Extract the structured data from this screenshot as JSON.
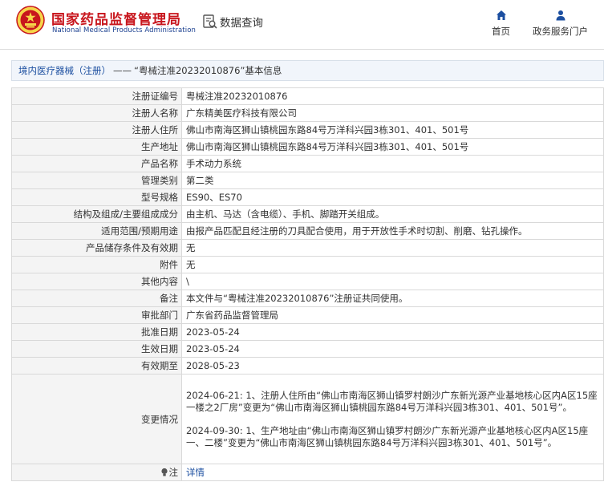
{
  "header": {
    "site_name_cn": "国家药品监督管理局",
    "site_name_en": "National Medical Products Administration",
    "data_query": "数据查询",
    "nav": {
      "home": "首页",
      "gov_service": "政务服务门户"
    }
  },
  "breadcrumb": {
    "category": "境内医疗器械（注册）",
    "separator": "——",
    "title": "“粤械注准20232010876”基本信息"
  },
  "record": {
    "rows": [
      {
        "label": "注册证编号",
        "value": "粤械注准20232010876"
      },
      {
        "label": "注册人名称",
        "value": "广东精美医疗科技有限公司"
      },
      {
        "label": "注册人住所",
        "value": "佛山市南海区狮山镇桃园东路84号万洋科兴园3栋301、401、501号"
      },
      {
        "label": "生产地址",
        "value": "佛山市南海区狮山镇桃园东路84号万洋科兴园3栋301、401、501号"
      },
      {
        "label": "产品名称",
        "value": "手术动力系统"
      },
      {
        "label": "管理类别",
        "value": "第二类"
      },
      {
        "label": "型号规格",
        "value": "ES90、ES70"
      },
      {
        "label": "结构及组成/主要组成成分",
        "value": "由主机、马达（含电缆）、手机、脚踏开关组成。"
      },
      {
        "label": "适用范围/预期用途",
        "value": "由报产品匹配且经注册的刀具配合使用，用于开放性手术时切割、削磨、钻孔操作。"
      },
      {
        "label": "产品储存条件及有效期",
        "value": "无"
      },
      {
        "label": "附件",
        "value": "无"
      },
      {
        "label": "其他内容",
        "value": "\\"
      },
      {
        "label": "备注",
        "value": "本文件与“粤械注准20232010876”注册证共同使用。"
      },
      {
        "label": "审批部门",
        "value": "广东省药品监督管理局"
      },
      {
        "label": "批准日期",
        "value": "2023-05-24"
      },
      {
        "label": "生效日期",
        "value": "2023-05-24"
      },
      {
        "label": "有效期至",
        "value": "2028-05-23"
      }
    ],
    "changes": {
      "label": "变更情况",
      "entries": [
        "2024-06-21: 1、注册人住所由“佛山市南海区狮山镇罗村朗沙广东新光源产业基地核心区内A区15座一楼之2厂房”变更为“佛山市南海区狮山镇桃园东路84号万洋科兴园3栋301、401、501号”。",
        "2024-09-30: 1、生产地址由“佛山市南海区狮山镇罗村朗沙广东新光源产业基地核心区内A区15座一、二楼”变更为“佛山市南海区狮山镇桃园东路84号万洋科兴园3栋301、401、501号”。"
      ]
    },
    "note": {
      "label": "注",
      "link": "详情"
    }
  }
}
